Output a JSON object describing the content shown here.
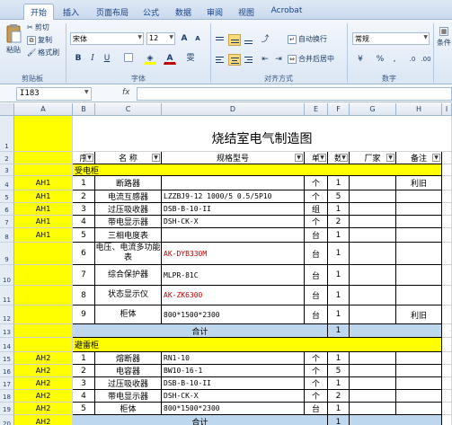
{
  "tabs": [
    "开始",
    "插入",
    "页面布局",
    "公式",
    "数据",
    "审阅",
    "视图",
    "Acrobat"
  ],
  "clipboard": {
    "paste": "粘贴",
    "cut": "剪切",
    "copy": "复制",
    "format_painter": "格式刷",
    "group": "剪贴板"
  },
  "font": {
    "name": "宋体",
    "size": "12",
    "group": "字体"
  },
  "alignment": {
    "wrap": "自动换行",
    "merge": "合并后居中",
    "group": "对齐方式"
  },
  "number": {
    "format": "常规",
    "group": "数字",
    "percent": "%",
    "comma": ","
  },
  "styles": {
    "label": "条件"
  },
  "formula_bar": {
    "name_box": "I183",
    "fx": "fx",
    "value": ""
  },
  "columns": [
    "A",
    "B",
    "C",
    "D",
    "E",
    "F",
    "G",
    "H",
    "I"
  ],
  "sheet": {
    "title": "烧结室电气制造图",
    "headers": {
      "seq": "序",
      "name": "名 称",
      "model": "规格型号",
      "unit": "单",
      "qty": "数",
      "maker": "厂家",
      "note": "备注"
    },
    "section1": "受电柜",
    "section2": "避雷柜",
    "rows": [
      {
        "rn": "4",
        "code": "AH1",
        "seq": "1",
        "name": "断路器",
        "model": "",
        "unit": "个",
        "qty": "1",
        "note": "利旧"
      },
      {
        "rn": "5",
        "code": "AH1",
        "seq": "2",
        "name": "电流互感器",
        "model": "LZZBJ9-12  1000/5  0.5/5P10",
        "unit": "个",
        "qty": "5",
        "note": ""
      },
      {
        "rn": "6",
        "code": "AH1",
        "seq": "3",
        "name": "过压吸收器",
        "model": "DSB-B-10-II",
        "unit": "组",
        "qty": "1",
        "note": ""
      },
      {
        "rn": "7",
        "code": "AH1",
        "seq": "4",
        "name": "带电显示器",
        "model": "DSH-CK-X",
        "unit": "个",
        "qty": "2",
        "note": ""
      },
      {
        "rn": "8",
        "code": "AH1",
        "seq": "5",
        "name": "三相电度表",
        "model": "",
        "unit": "台",
        "qty": "1",
        "note": ""
      },
      {
        "rn": "9",
        "code": "",
        "seq": "6",
        "name": "电压、电流多功能表",
        "model": "AK-DYB330M",
        "unit": "台",
        "qty": "1",
        "note": "",
        "red": true
      },
      {
        "rn": "10",
        "code": "",
        "seq": "7",
        "name": "综合保护器",
        "model": "MLPR-81C",
        "unit": "台",
        "qty": "1",
        "note": ""
      },
      {
        "rn": "11",
        "code": "",
        "seq": "8",
        "name": "状态显示仪",
        "model": "AK-ZK6300",
        "unit": "台",
        "qty": "1",
        "note": "",
        "red": true
      },
      {
        "rn": "12",
        "code": "",
        "seq": "9",
        "name": "柜体",
        "model": "800*1500*2300",
        "unit": "台",
        "qty": "1",
        "note": "利旧"
      }
    ],
    "subtotal1": {
      "rn": "13",
      "label": "合计",
      "qty": "1"
    },
    "rows2": [
      {
        "rn": "15",
        "code": "AH2",
        "seq": "1",
        "name": "熔断器",
        "model": "RN1-10",
        "unit": "个",
        "qty": "1",
        "note": ""
      },
      {
        "rn": "16",
        "code": "AH2",
        "seq": "2",
        "name": "电容器",
        "model": "BW10-16-1",
        "unit": "个",
        "qty": "5",
        "note": ""
      },
      {
        "rn": "17",
        "code": "AH2",
        "seq": "3",
        "name": "过压吸收器",
        "model": "DSB-B-10-II",
        "unit": "个",
        "qty": "1",
        "note": ""
      },
      {
        "rn": "18",
        "code": "AH2",
        "seq": "4",
        "name": "带电显示器",
        "model": "DSH-CK-X",
        "unit": "个",
        "qty": "2",
        "note": ""
      },
      {
        "rn": "19",
        "code": "AH2",
        "seq": "5",
        "name": "柜体",
        "model": "800*1500*2300",
        "unit": "台",
        "qty": "1",
        "note": ""
      }
    ],
    "subtotal2": {
      "rn": "20",
      "code": "AH2",
      "label": "合计",
      "qty": "1"
    },
    "header_rows": [
      "1",
      "2",
      "3",
      "14"
    ]
  },
  "colors": {
    "yellow": "#ffff00",
    "subtotal_blue": "#bdd7ee",
    "accent": "#15428b"
  }
}
